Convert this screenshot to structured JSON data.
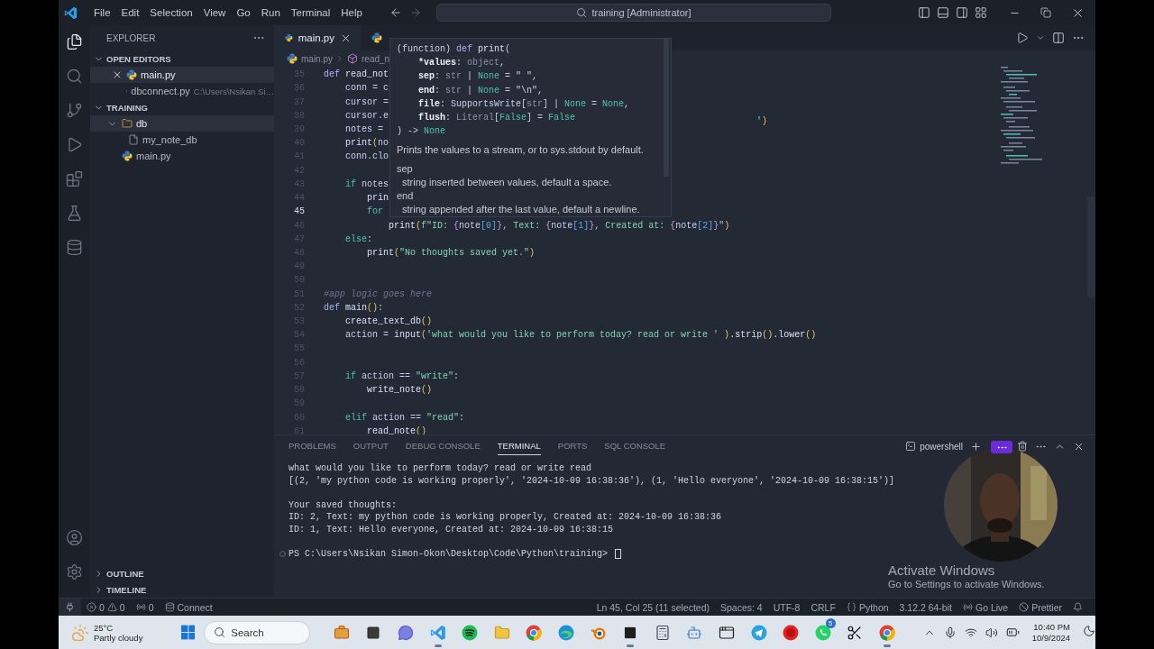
{
  "title_bar": {
    "menus": [
      "File",
      "Edit",
      "Selection",
      "View",
      "Go",
      "Run",
      "Terminal",
      "Help"
    ],
    "command_center": "training [Administrator]"
  },
  "activity_bar": {
    "top": [
      {
        "kind": "explorer",
        "selected": true
      },
      {
        "kind": "search",
        "selected": false
      },
      {
        "kind": "source_control",
        "selected": false
      },
      {
        "kind": "run",
        "selected": false
      },
      {
        "kind": "extensions",
        "selected": false
      },
      {
        "kind": "testing",
        "selected": false
      },
      {
        "kind": "database",
        "selected": false
      }
    ],
    "bottom": [
      {
        "kind": "account"
      },
      {
        "kind": "settings"
      }
    ]
  },
  "sidebar": {
    "title": "EXPLORER",
    "open_editors": {
      "label": "OPEN EDITORS",
      "expanded": true,
      "items": [
        {
          "name": "main.py",
          "selected": true
        },
        {
          "name": "dbconnect.py",
          "path": "C:\\Users\\Nsikan Si…",
          "selected": false
        }
      ]
    },
    "folder": {
      "label": "TRAINING",
      "expanded": true,
      "items": [
        {
          "name": "db",
          "kind": "folder",
          "expanded": true,
          "selected": true,
          "children": [
            {
              "name": "my_note_db",
              "kind": "file",
              "selected": false
            }
          ]
        },
        {
          "name": "main.py",
          "kind": "python",
          "selected": false
        }
      ]
    },
    "bottom_sections": [
      {
        "label": "OUTLINE",
        "expanded": false
      },
      {
        "label": "TIMELINE",
        "expanded": false
      }
    ]
  },
  "editor": {
    "tabs": [
      {
        "label": "main.py",
        "selected": true
      },
      {
        "selected": false
      }
    ],
    "breadcrumbs": [
      {
        "kind": "file",
        "label": "main.py"
      },
      {
        "kind": "symbol",
        "label": "read_n"
      }
    ],
    "lines": [
      {
        "num": "35",
        "current": false,
        "tokens": [
          {
            "kind": "def",
            "text": "def "
          },
          {
            "kind": "fn",
            "text": "read_not"
          }
        ]
      },
      {
        "num": "36",
        "current": false,
        "tokens": [
          {
            "kind": "plain",
            "text": "    conn = c"
          }
        ]
      },
      {
        "num": "37",
        "current": false,
        "tokens": [
          {
            "kind": "plain",
            "text": "    cursor ="
          }
        ]
      },
      {
        "num": "38",
        "current": false,
        "tokens": [
          {
            "kind": "plain",
            "text": "    cursor.e"
          }
        ],
        "tail": [
          {
            "kind": "str",
            "text": "'"
          },
          {
            "kind": "paren",
            "text": ")"
          }
        ]
      },
      {
        "num": "39",
        "current": false,
        "tokens": [
          {
            "kind": "plain",
            "text": "    notes ="
          }
        ]
      },
      {
        "num": "40",
        "current": false,
        "tokens": [
          {
            "kind": "fn",
            "text": "    print"
          },
          {
            "kind": "paren",
            "text": "("
          },
          {
            "kind": "plain",
            "text": "no"
          }
        ]
      },
      {
        "num": "41",
        "current": false,
        "tokens": [
          {
            "kind": "plain",
            "text": "    conn.clo"
          }
        ]
      },
      {
        "num": "42",
        "current": false
      },
      {
        "num": "43",
        "current": false,
        "tokens": [
          {
            "kind": "ctrl",
            "text": "    if"
          },
          {
            "kind": "plain",
            "text": " notes"
          }
        ]
      },
      {
        "num": "44",
        "current": false,
        "tokens": [
          {
            "kind": "fn",
            "text": "        prin"
          }
        ]
      },
      {
        "num": "45",
        "current": true,
        "tokens": [
          {
            "kind": "ctrl",
            "text": "        for"
          }
        ]
      },
      {
        "num": "46",
        "current": false,
        "tokens": [
          {
            "kind": "fn",
            "text": "            print"
          },
          {
            "kind": "paren",
            "text": "("
          },
          {
            "kind": "str",
            "text": "f\"ID: "
          },
          {
            "kind": "brace",
            "text": "{"
          },
          {
            "kind": "plain",
            "text": "note"
          },
          {
            "kind": "index",
            "text": "[0]"
          },
          {
            "kind": "brace",
            "text": "}"
          },
          {
            "kind": "str",
            "text": ", Text: "
          },
          {
            "kind": "brace",
            "text": "{"
          },
          {
            "kind": "plain",
            "text": "note"
          },
          {
            "kind": "index",
            "text": "[1]"
          },
          {
            "kind": "brace",
            "text": "}"
          },
          {
            "kind": "str",
            "text": ", Created at: "
          },
          {
            "kind": "brace",
            "text": "{"
          },
          {
            "kind": "plain",
            "text": "note"
          },
          {
            "kind": "index",
            "text": "[2]"
          },
          {
            "kind": "brace",
            "text": "}"
          },
          {
            "kind": "str",
            "text": "\""
          },
          {
            "kind": "paren",
            "text": ")"
          }
        ]
      },
      {
        "num": "47",
        "current": false,
        "tokens": [
          {
            "kind": "ctrl",
            "text": "    else"
          },
          {
            "kind": "plain",
            "text": ":"
          }
        ]
      },
      {
        "num": "48",
        "current": false,
        "tokens": [
          {
            "kind": "fn",
            "text": "        print"
          },
          {
            "kind": "paren",
            "text": "("
          },
          {
            "kind": "str",
            "text": "\"No thoughts saved yet.\""
          },
          {
            "kind": "paren",
            "text": ")"
          }
        ]
      },
      {
        "num": "49",
        "current": false
      },
      {
        "num": "50",
        "current": false
      },
      {
        "num": "51",
        "current": false,
        "tokens": [
          {
            "kind": "comment",
            "text": "#app logic goes here"
          }
        ]
      },
      {
        "num": "52",
        "current": false,
        "tokens": [
          {
            "kind": "def",
            "text": "def "
          },
          {
            "kind": "fn",
            "text": "main"
          },
          {
            "kind": "paren",
            "text": "()"
          },
          {
            "kind": "plain",
            "text": ":"
          }
        ]
      },
      {
        "num": "53",
        "current": false,
        "tokens": [
          {
            "kind": "fn",
            "text": "    create_text_db"
          },
          {
            "kind": "paren",
            "text": "()"
          }
        ]
      },
      {
        "num": "54",
        "current": false,
        "tokens": [
          {
            "kind": "plain",
            "text": "    action = "
          },
          {
            "kind": "fn",
            "text": "input"
          },
          {
            "kind": "paren",
            "text": "("
          },
          {
            "kind": "str",
            "text": "'what would you like to perform today? read or write '"
          },
          {
            "kind": "paren",
            "text": " )"
          },
          {
            "kind": "fn",
            "text": ".strip"
          },
          {
            "kind": "paren",
            "text": "()"
          },
          {
            "kind": "fn",
            "text": ".lower"
          },
          {
            "kind": "paren",
            "text": "()"
          }
        ]
      },
      {
        "num": "55",
        "current": false
      },
      {
        "num": "56",
        "current": false
      },
      {
        "num": "57",
        "current": false,
        "tokens": [
          {
            "kind": "ctrl",
            "text": "    if"
          },
          {
            "kind": "plain",
            "text": " action == "
          },
          {
            "kind": "str",
            "text": "\"write\""
          },
          {
            "kind": "plain",
            "text": ":"
          }
        ]
      },
      {
        "num": "58",
        "current": false,
        "tokens": [
          {
            "kind": "fn",
            "text": "        write_note"
          },
          {
            "kind": "paren",
            "text": "()"
          }
        ]
      },
      {
        "num": "59",
        "current": false
      },
      {
        "num": "60",
        "current": false,
        "tokens": [
          {
            "kind": "ctrl",
            "text": "    elif"
          },
          {
            "kind": "plain",
            "text": " action == "
          },
          {
            "kind": "str",
            "text": "\"read\""
          },
          {
            "kind": "plain",
            "text": ":"
          }
        ]
      },
      {
        "num": "61",
        "current": false,
        "tokens": [
          {
            "kind": "fn",
            "text": "        read_note"
          },
          {
            "kind": "paren",
            "text": "()"
          }
        ]
      }
    ],
    "hover": {
      "signature": [
        [
          {
            "kind": "plain",
            "text": "(function) "
          },
          {
            "kind": "def",
            "text": "def "
          },
          {
            "kind": "fn",
            "text": "print"
          },
          {
            "kind": "plain",
            "text": "("
          }
        ],
        [
          {
            "kind": "param",
            "text": "    *values"
          },
          {
            "kind": "plain",
            "text": ": "
          },
          {
            "kind": "type",
            "text": "object"
          },
          {
            "kind": "plain",
            "text": ","
          }
        ],
        [
          {
            "kind": "param",
            "text": "    sep"
          },
          {
            "kind": "plain",
            "text": ": "
          },
          {
            "kind": "type",
            "text": "str"
          },
          {
            "kind": "plain",
            "text": " | "
          },
          {
            "kind": "const",
            "text": "None"
          },
          {
            "kind": "plain",
            "text": " = \" \","
          }
        ],
        [
          {
            "kind": "param",
            "text": "    end"
          },
          {
            "kind": "plain",
            "text": ": "
          },
          {
            "kind": "type",
            "text": "str"
          },
          {
            "kind": "plain",
            "text": " | "
          },
          {
            "kind": "const",
            "text": "None"
          },
          {
            "kind": "plain",
            "text": " = \"\\n\","
          }
        ],
        [
          {
            "kind": "param",
            "text": "    file"
          },
          {
            "kind": "plain",
            "text": ": SupportsWrite["
          },
          {
            "kind": "type",
            "text": "str"
          },
          {
            "kind": "plain",
            "text": "] | "
          },
          {
            "kind": "const",
            "text": "None"
          },
          {
            "kind": "plain",
            "text": " = "
          },
          {
            "kind": "const",
            "text": "None"
          },
          {
            "kind": "plain",
            "text": ","
          }
        ],
        [
          {
            "kind": "param",
            "text": "    flush"
          },
          {
            "kind": "plain",
            "text": ": "
          },
          {
            "kind": "type",
            "text": "Literal"
          },
          {
            "kind": "plain",
            "text": "["
          },
          {
            "kind": "const",
            "text": "False"
          },
          {
            "kind": "plain",
            "text": "] = "
          },
          {
            "kind": "const",
            "text": "False"
          }
        ],
        [
          {
            "kind": "plain",
            "text": ") -> "
          },
          {
            "kind": "const",
            "text": "None"
          }
        ]
      ],
      "description": "Prints the values to a stream, or to sys.stdout by default.",
      "params": [
        {
          "name": "sep",
          "text": "string inserted between values, default a space."
        },
        {
          "name": "end",
          "text": "string appended after the last value, default a newline."
        }
      ]
    }
  },
  "panel": {
    "tabs": [
      {
        "label": "PROBLEMS",
        "selected": false
      },
      {
        "label": "OUTPUT",
        "selected": false
      },
      {
        "label": "DEBUG CONSOLE",
        "selected": false
      },
      {
        "label": "TERMINAL",
        "selected": true
      },
      {
        "label": "PORTS",
        "selected": false
      },
      {
        "label": "SQL CONSOLE",
        "selected": false
      }
    ],
    "shell": "powershell",
    "output_blocks": [
      {
        "lines": [
          "what would you like to perform today? read or write read",
          "[(2, 'my python code is working properly', '2024-10-09 16:38:36'), (1, 'Hello everyone', '2024-10-09 16:38:15')]"
        ]
      },
      {
        "lines": [
          "Your saved thoughts:",
          "ID: 2, Text: my python code is working properly, Created at: 2024-10-09 16:38:36",
          "ID: 1, Text: Hello everyone, Created at: 2024-10-09 16:38:15"
        ]
      }
    ],
    "prompt": "PS C:\\Users\\Nsikan Simon-Okon\\Desktop\\Code\\Python\\training>"
  },
  "activation": {
    "title": "Activate Windows",
    "subtitle": "Go to Settings to activate Windows."
  },
  "status_bar": {
    "errors": "0",
    "warnings": "0",
    "ports": "0",
    "connect": "Connect",
    "right": [
      {
        "kind": "text",
        "text": "Ln 45, Col 25 (11 selected)"
      },
      {
        "kind": "text",
        "text": "Spaces: 4"
      },
      {
        "kind": "text",
        "text": "UTF-8"
      },
      {
        "kind": "text",
        "text": "CRLF"
      },
      {
        "kind": "language",
        "text": "Python"
      },
      {
        "kind": "text",
        "text": "3.12.2 64-bit"
      },
      {
        "kind": "golive",
        "text": "Go Live"
      },
      {
        "kind": "prettier",
        "text": "Prettier"
      },
      {
        "kind": "bell"
      }
    ]
  },
  "taskbar": {
    "weather": {
      "temp": "25°C",
      "condition": "Partly cloudy"
    },
    "search": {
      "placeholder": "Search"
    },
    "apps": [
      {
        "kind": "briefcase",
        "running": false
      },
      {
        "kind": "window",
        "running": false
      },
      {
        "kind": "chat",
        "running": false
      },
      {
        "kind": "code",
        "running": true
      },
      {
        "kind": "music",
        "running": false
      },
      {
        "kind": "folder",
        "running": false
      },
      {
        "kind": "browser",
        "running": false
      },
      {
        "kind": "wave",
        "running": false
      },
      {
        "kind": "orbit",
        "running": false
      },
      {
        "kind": "terminal",
        "running": true
      },
      {
        "kind": "calculator",
        "running": false
      },
      {
        "kind": "robot",
        "running": false
      },
      {
        "kind": "appwindow",
        "running": false
      },
      {
        "kind": "plane",
        "running": false
      },
      {
        "kind": "record",
        "running": false
      },
      {
        "kind": "phone",
        "running": false,
        "badge": "5"
      },
      {
        "kind": "scissors",
        "running": false
      },
      {
        "kind": "browser",
        "running": true
      }
    ],
    "clock": {
      "time": "10:40 PM",
      "date": "10/9/2024"
    }
  }
}
